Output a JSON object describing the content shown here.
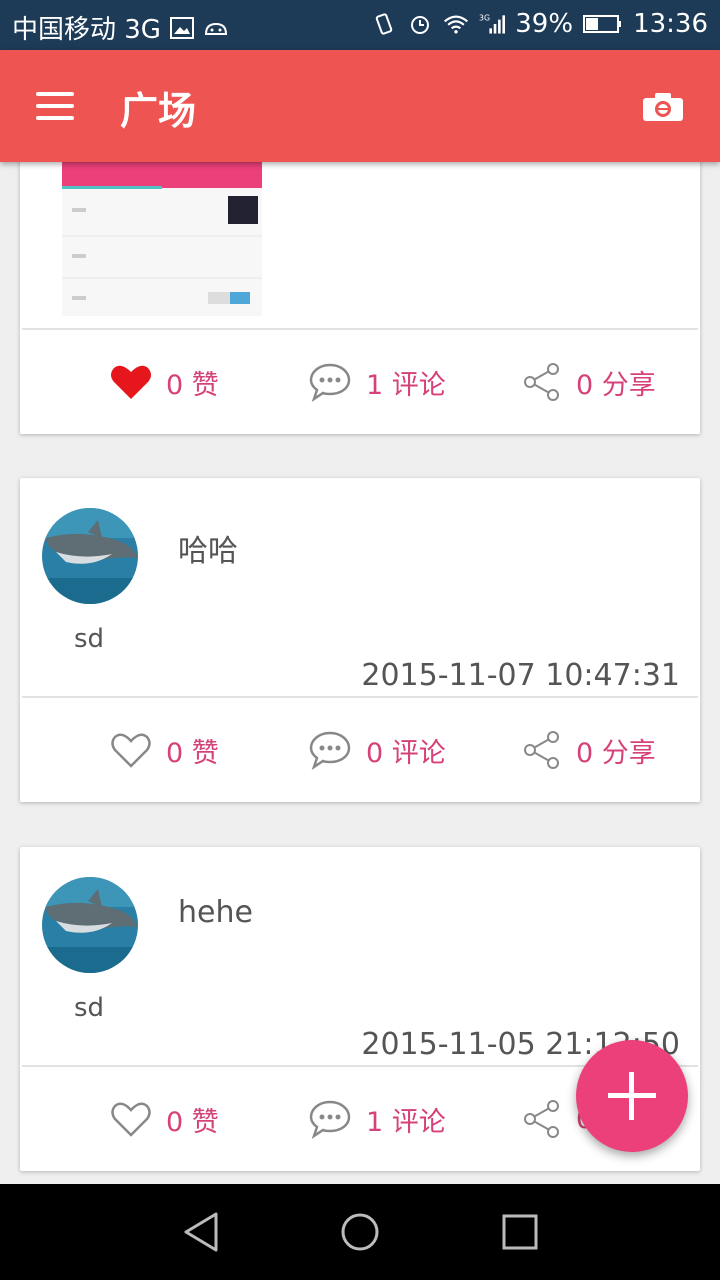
{
  "status_bar": {
    "carrier": "中国移动 3G",
    "battery": "39%",
    "time": "13:36"
  },
  "app_bar": {
    "title": "广场"
  },
  "posts": [
    {
      "likes": "0 赞",
      "comments": "1 评论",
      "shares": "0 分享",
      "liked": true
    },
    {
      "content": "哈哈",
      "username": "sd",
      "timestamp": "2015-11-07 10:47:31",
      "likes": "0 赞",
      "comments": "0 评论",
      "shares": "0 分享",
      "liked": false
    },
    {
      "content": "hehe",
      "username": "sd",
      "timestamp": "2015-11-05 21:12:50",
      "likes": "0 赞",
      "comments": "1 评论",
      "shares": "0",
      "liked": false
    }
  ],
  "colors": {
    "status_bar": "#1d3a57",
    "app_bar": "#ee5452",
    "accent": "#d64179",
    "fab": "#ec407a",
    "like_active": "#e5161c"
  },
  "icons": {
    "menu": "menu-icon",
    "camera": "camera-icon",
    "like": "heart-icon",
    "comment": "comment-bubble-icon",
    "share": "share-icon",
    "fab": "plus-icon",
    "nav_back": "back-triangle-icon",
    "nav_home": "home-circle-icon",
    "nav_recents": "recents-square-icon"
  }
}
